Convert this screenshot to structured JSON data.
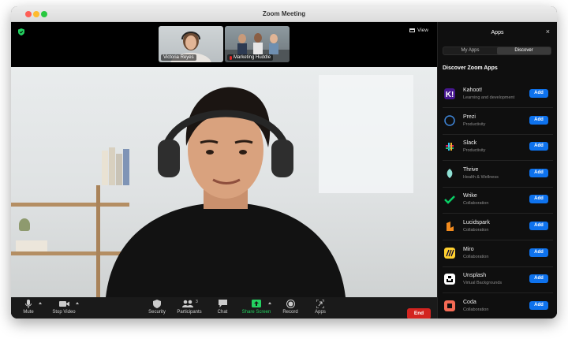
{
  "window": {
    "title": "Zoom Meeting"
  },
  "top": {
    "view_label": "View"
  },
  "thumbnails": [
    {
      "name": "Victoria Reyes"
    },
    {
      "name": "Marketing Huddle"
    }
  ],
  "toolbar": {
    "mute": "Mute",
    "stop_video": "Stop Video",
    "security": "Security",
    "participants": "Participants",
    "participants_count": "3",
    "chat": "Chat",
    "share_screen": "Share Screen",
    "record": "Record",
    "apps": "Apps",
    "end": "End"
  },
  "apps_panel": {
    "title": "Apps",
    "tabs": [
      "My Apps",
      "Discover"
    ],
    "active_tab": "Discover",
    "heading": "Discover Zoom Apps",
    "add_label": "Add",
    "apps": [
      {
        "name": "Kahoot!",
        "category": "Learning and development",
        "color": "#46178f",
        "icon": "kahoot-icon"
      },
      {
        "name": "Prezi",
        "category": "Productivity",
        "color": "#1557b0",
        "icon": "prezi-icon"
      },
      {
        "name": "Slack",
        "category": "Productivity",
        "color": "#000000",
        "icon": "slack-icon"
      },
      {
        "name": "Thrive",
        "category": "Health & Wellness",
        "color": "#66c2b8",
        "icon": "thrive-icon"
      },
      {
        "name": "Wrike",
        "category": "Collaboration",
        "color": "#08cf65",
        "icon": "wrike-icon"
      },
      {
        "name": "Lucidspark",
        "category": "Collaboration",
        "color": "#f28b1e",
        "icon": "lucidspark-icon"
      },
      {
        "name": "Miro",
        "category": "Collaboration",
        "color": "#ffd02f",
        "icon": "miro-icon"
      },
      {
        "name": "Unsplash",
        "category": "Virtual Backgrounds",
        "color": "#ffffff",
        "icon": "unsplash-icon"
      },
      {
        "name": "Coda",
        "category": "Collaboration",
        "color": "#f46a54",
        "icon": "coda-icon"
      }
    ]
  },
  "colors": {
    "share_green": "#23d160",
    "end_red": "#d32420",
    "add_blue": "#0e72ed"
  }
}
